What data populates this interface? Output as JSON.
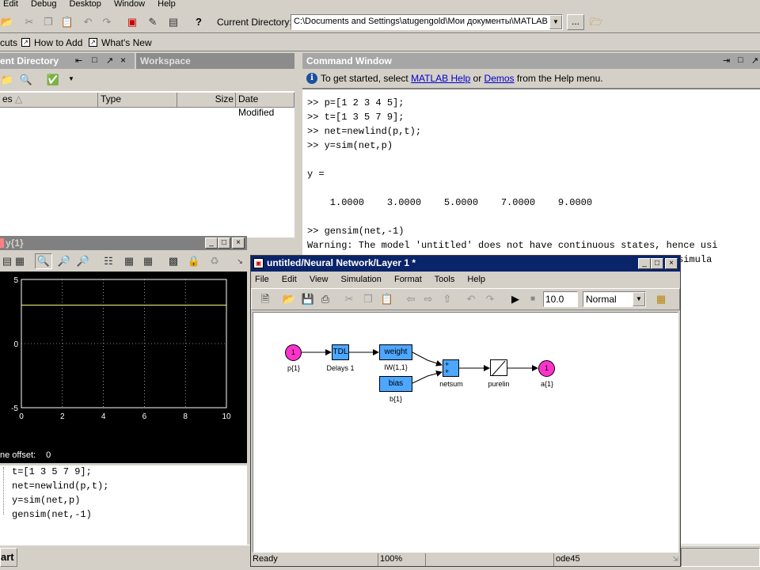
{
  "menubar": {
    "items": [
      "Edit",
      "Debug",
      "Desktop",
      "Window",
      "Help"
    ]
  },
  "toolbar": {
    "current_dir_label": "Current Directory:",
    "current_dir_value": "C:\\Documents and Settings\\atugengold\\Мои документы\\MATLAB",
    "browse_label": "..."
  },
  "shortcuts": {
    "label": "cuts",
    "how_to_add": "How to Add",
    "whats_new": "What's New"
  },
  "curdir_panel": {
    "title": "ent Directory",
    "workspace_tab": "Workspace",
    "columns": [
      "es",
      "Type",
      "Size",
      "Date Modified"
    ]
  },
  "command_window": {
    "title": "Command Window",
    "info_prefix": "To get started, select ",
    "info_link1": "MATLAB Help",
    "info_mid": " or ",
    "info_link2": "Demos",
    "info_suffix": " from the Help menu.",
    "lines": [
      ">> p=[1 2 3 4 5];",
      ">> t=[1 3 5 7 9];",
      ">> net=newlind(p,t);",
      ">> y=sim(net,p)",
      "",
      "y =",
      "",
      "    1.0000    3.0000    5.0000    7.0000    9.0000",
      "",
      ">> gensim(net,-1)",
      "Warning: The model 'untitled' does not have continuous states, hence usi",
      "                                                          .  The simula"
    ]
  },
  "scope": {
    "title": "y{1}",
    "time_offset_label": "ne offset:",
    "time_offset_value": "0",
    "chart_data": {
      "type": "line",
      "x": [
        0,
        10
      ],
      "series": [
        {
          "values": [
            3,
            3
          ]
        }
      ],
      "xlim": [
        0,
        10
      ],
      "ylim": [
        -5,
        5
      ],
      "xticks": [
        "0",
        "2",
        "4",
        "6",
        "8",
        "10"
      ],
      "yticks": [
        "5",
        "0",
        "-5"
      ],
      "grid": true,
      "line_color": "#ffff80"
    }
  },
  "history": {
    "lines": [
      "t=[1 3 5 7 9];",
      "net=newlind(p,t);",
      "y=sim(net,p)",
      "gensim(net,-1)"
    ]
  },
  "simulink": {
    "title": "untitled/Neural Network/Layer 1 *",
    "menu": [
      "File",
      "Edit",
      "View",
      "Simulation",
      "Format",
      "Tools",
      "Help"
    ],
    "stop_time": "10.0",
    "sim_mode": "Normal",
    "blocks": {
      "input_num": "1",
      "input_label": "p{1}",
      "tdl": "TDL",
      "tdl_label": "Delays 1",
      "weight": "weight",
      "weight_label": "IW{1,1}",
      "bias": "bias",
      "bias_label": "b{1}",
      "netsum_label": "netsum",
      "purelin_label": "purelin",
      "output_num": "1",
      "output_label": "a{1}"
    },
    "status": {
      "ready": "Ready",
      "zoom": "100%",
      "solver": "ode45"
    }
  },
  "taskbar": {
    "start": "art"
  },
  "colors": {
    "titlebar_active": "#0a246a",
    "titlebar_inactive": "#808080",
    "panel_header": "#a6a6a6",
    "block_fill": "#4da6ff",
    "port_fill": "#ff33cc"
  }
}
